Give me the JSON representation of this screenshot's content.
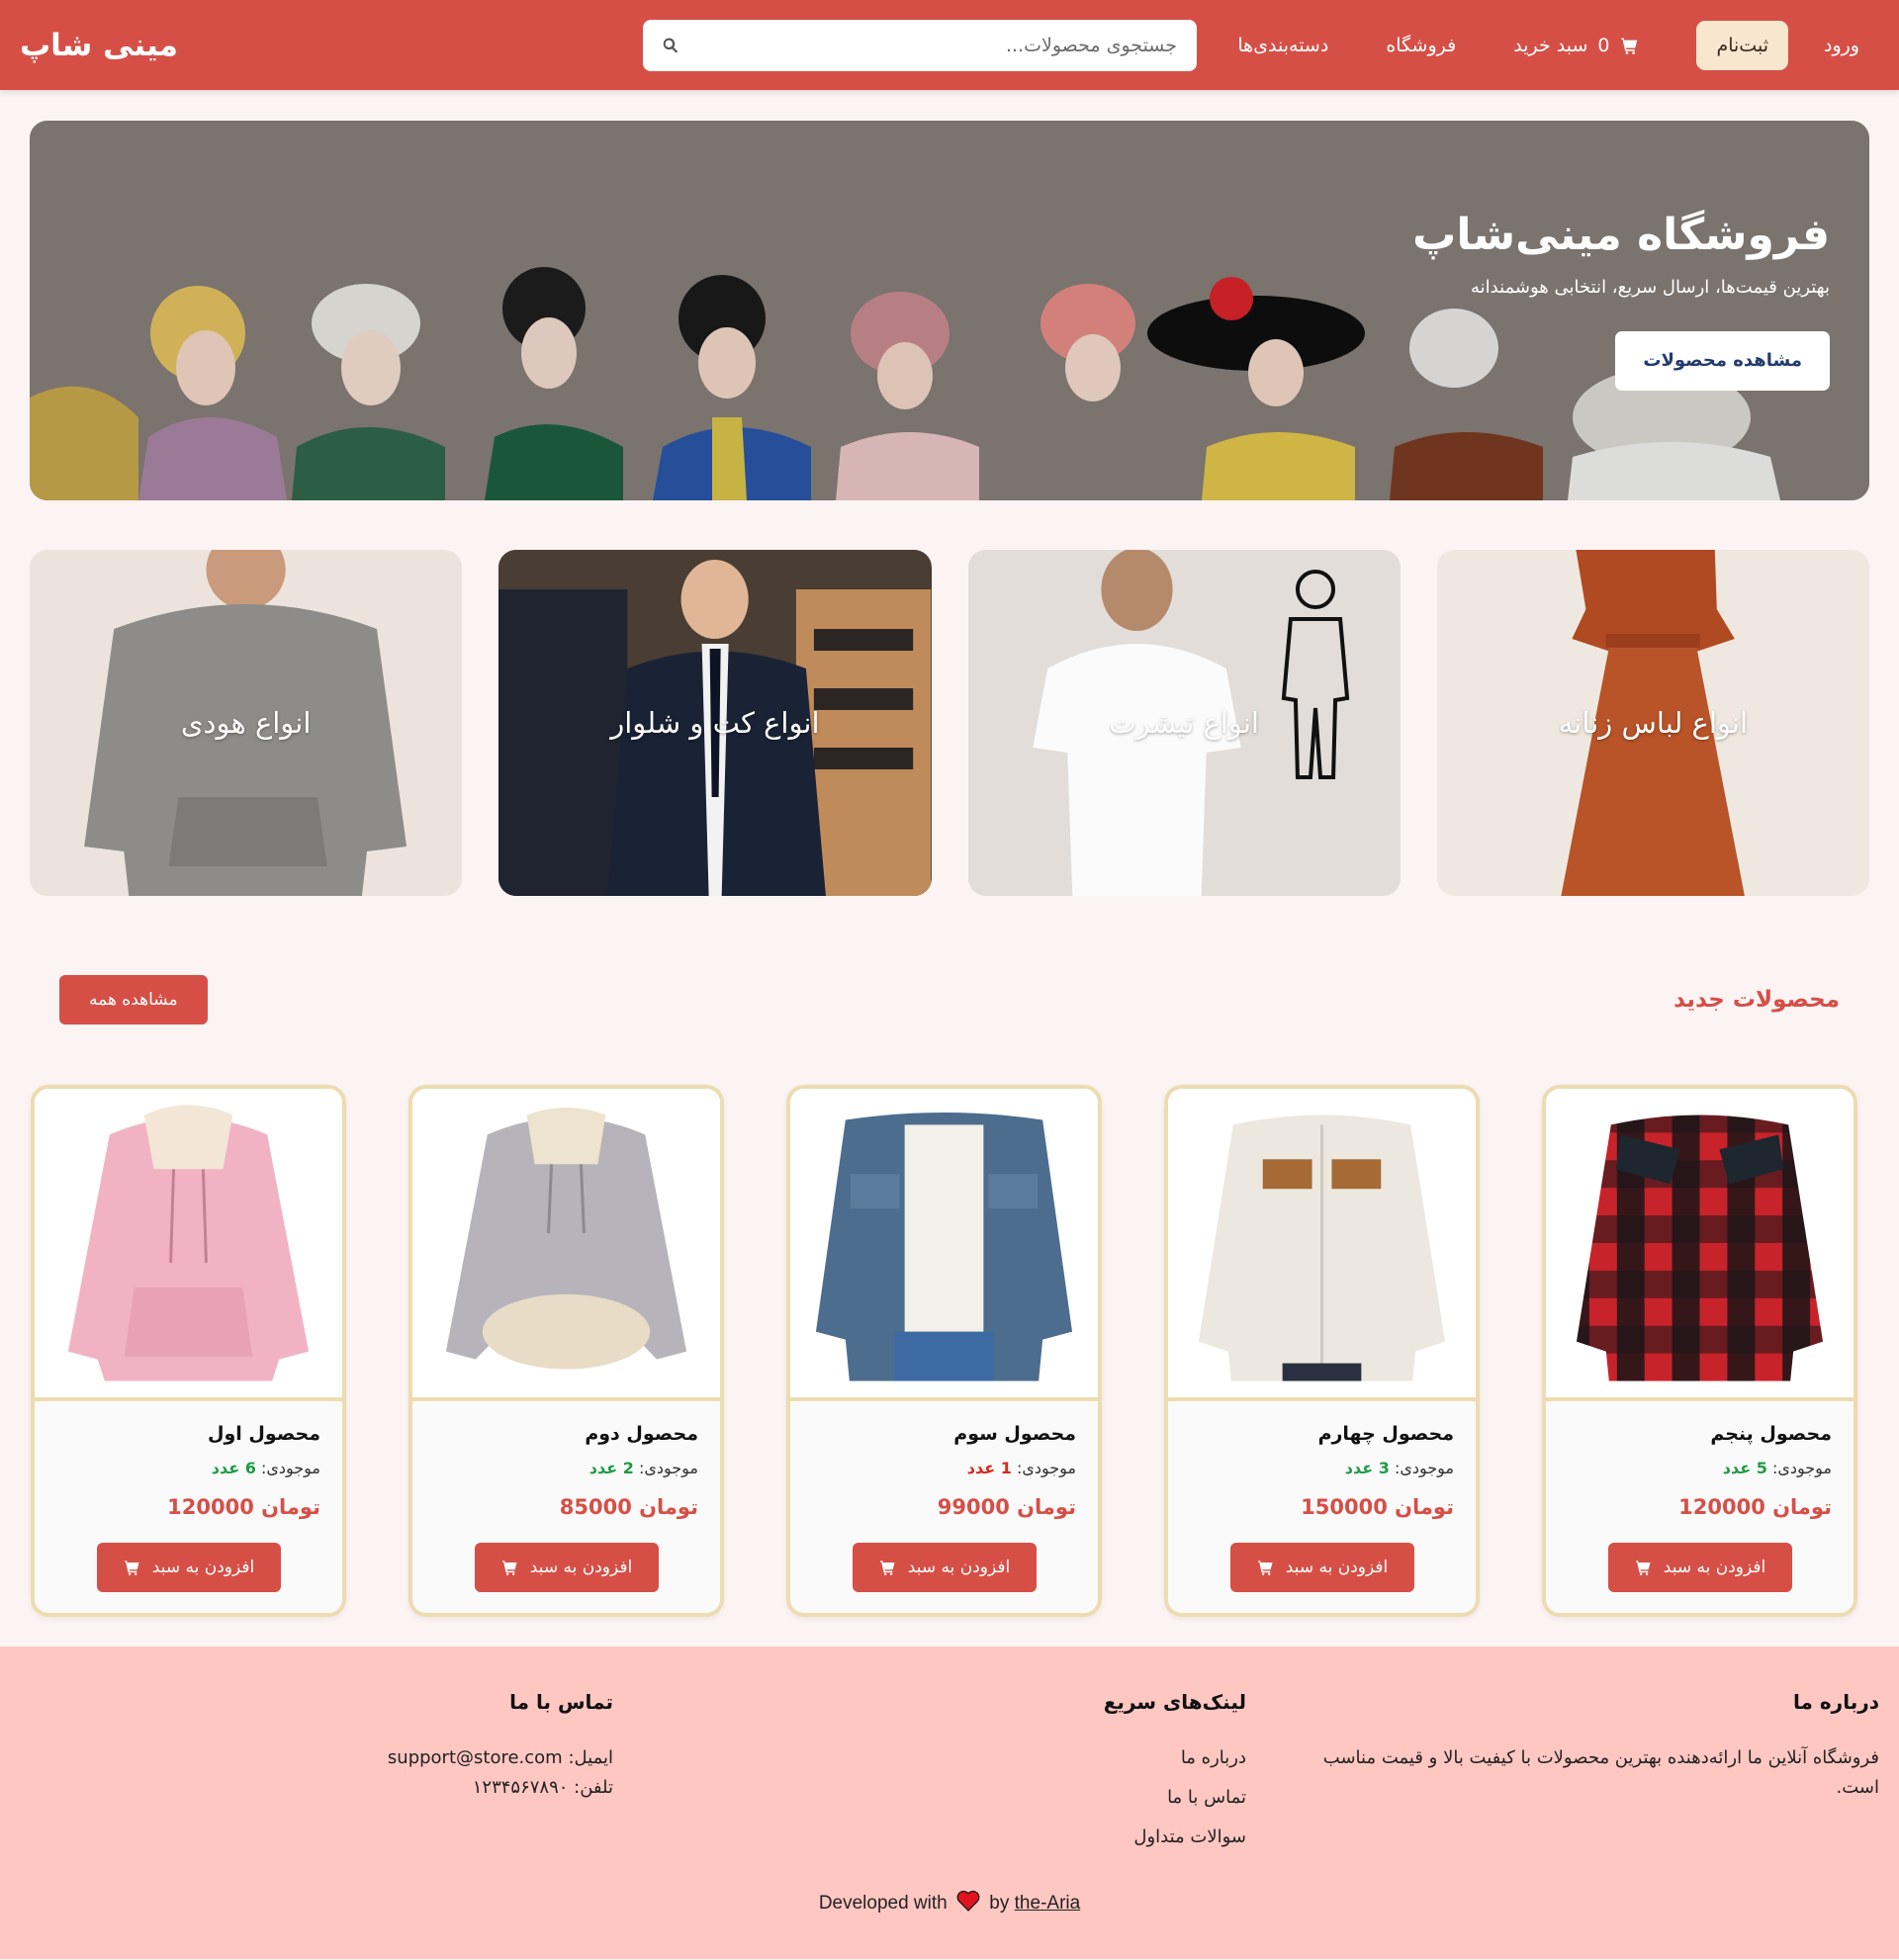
{
  "header": {
    "brand": "مینی شاپ",
    "nav": {
      "login": "ورود",
      "signup": "ثبت‌نام",
      "cart_count": "0",
      "cart_label": "سبد خرید",
      "shop": "فروشگاه",
      "categories": "دسته‌بندی‌ها"
    },
    "search": {
      "placeholder": "جستجوی محصولات..."
    },
    "colors": {
      "bar": "#d64f46",
      "signup_bg": "#f8e6cf"
    }
  },
  "hero": {
    "title": "فروشگاه مینی‌شاپ",
    "subtitle": "بهترین قیمت‌ها، ارسال سریع، انتخابی هوشمندانه",
    "button": "مشاهده محصولات"
  },
  "categories": [
    {
      "label": "انواع لباس زنانه"
    },
    {
      "label": "انواع تیشرت"
    },
    {
      "label": "انواع کت و شلوار"
    },
    {
      "label": "انواع هودی"
    }
  ],
  "new_products": {
    "title": "محصولات جدید",
    "view_all": "مشاهده همه",
    "stock_label": "موجودی:",
    "currency": "تومان",
    "add_to_cart": "افزودن به سبد",
    "items": [
      {
        "name": "محصول پنجم",
        "stock": "5 عدد",
        "price": "120000",
        "image": "red-plaid-jacket"
      },
      {
        "name": "محصول چهارم",
        "stock": "3 عدد",
        "price": "150000",
        "image": "white-sherpa-jacket"
      },
      {
        "name": "محصول سوم",
        "stock": "1 عدد",
        "price": "99000",
        "image": "denim-jacket"
      },
      {
        "name": "محصول دوم",
        "stock": "2 عدد",
        "price": "85000",
        "image": "grey-fleece-hoodie"
      },
      {
        "name": "محصول اول",
        "stock": "6 عدد",
        "price": "120000",
        "image": "pink-hoodie"
      }
    ]
  },
  "footer": {
    "about": {
      "title": "درباره ما",
      "text": "فروشگاه آنلاین ما ارائه‌دهنده بهترین محصولات با کیفیت بالا و قیمت مناسب است."
    },
    "links": {
      "title": "لینک‌های سریع",
      "items": [
        "درباره ما",
        "تماس با ما",
        "سوالات متداول"
      ]
    },
    "contact": {
      "title": "تماس با ما",
      "email": "ایمیل: support@store.com",
      "phone": "تلفن: ۱۲۳۴۵۶۷۸۹۰"
    },
    "credit": {
      "prefix": "Developed with",
      "by": "by",
      "author": "the-Aria"
    },
    "colors": {
      "background": "#ffc7c1"
    }
  }
}
